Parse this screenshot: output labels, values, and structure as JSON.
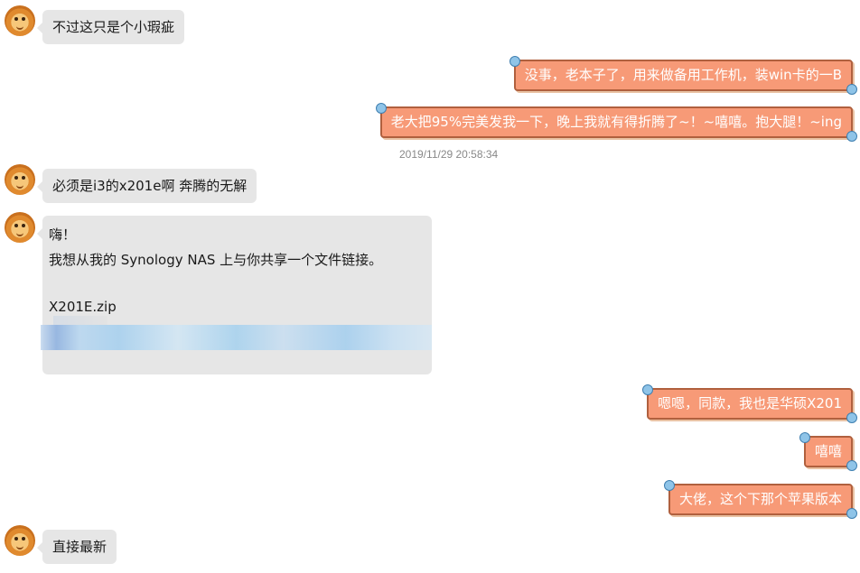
{
  "messages": [
    {
      "id": "m1",
      "side": "in",
      "text": "不过这只是个小瑕疵"
    },
    {
      "id": "m2",
      "side": "out",
      "text": "没事，老本子了，用来做备用工作机，装win卡的一B"
    },
    {
      "id": "m3",
      "side": "out",
      "text": "老大把95%完美发我一下，晚上我就有得折腾了~！~嘻嘻。抱大腿！~ing"
    },
    {
      "id": "m4",
      "side": "in",
      "text": "必须是i3的x201e啊 奔腾的无解"
    },
    {
      "id": "m6",
      "side": "out",
      "text": "嗯嗯，同款，我也是华硕X201"
    },
    {
      "id": "m7",
      "side": "out",
      "text": "嘻嘻"
    },
    {
      "id": "m8",
      "side": "out",
      "text": "大佬，这个下那个苹果版本"
    },
    {
      "id": "m9",
      "side": "in",
      "text": "直接最新"
    }
  ],
  "timestamp": "2019/11/29 20:58:34",
  "share_card": {
    "greeting": "嗨！",
    "body": "我想从我的 Synology NAS 上与你共享一个文件链接。",
    "filename": "X201E.zip"
  },
  "colors": {
    "incoming_bubble": "#e6e6e6",
    "outgoing_bubble": "#f79a77",
    "outgoing_border": "#b0603e",
    "timestamp": "#888888"
  },
  "icons": {
    "avatar": "lion-avatar-icon"
  }
}
